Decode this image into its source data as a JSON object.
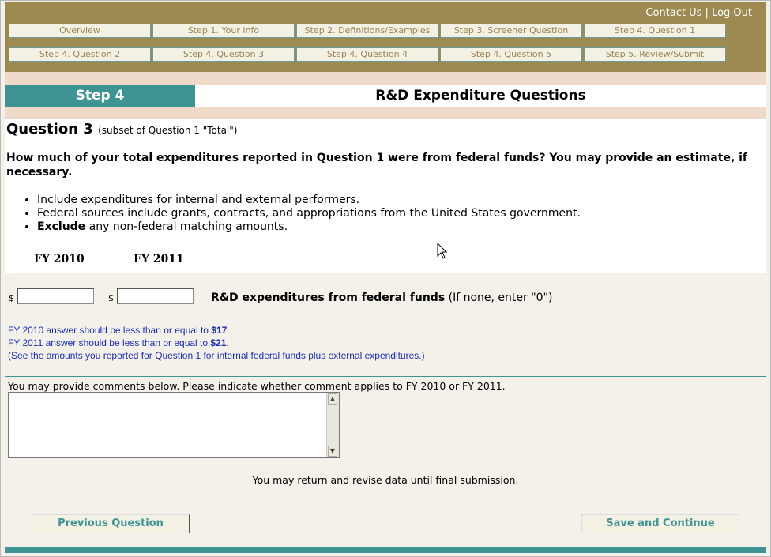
{
  "header": {
    "contact_label": "Contact Us",
    "separator": " | ",
    "logout_label": "Log Out",
    "nav": [
      "Overview",
      "Step 1. Your Info",
      "Step 2. Definitions/Examples",
      "Step 3. Screener Question",
      "Step 4. Question 1",
      "Step 4. Question 2",
      "Step 4. Question 3",
      "Step 4. Question 4",
      "Step 4. Question 5",
      "Step 5. Review/Submit"
    ]
  },
  "step": {
    "tag": "Step 4",
    "title": "R&D Expenditure Questions"
  },
  "question": {
    "title": "Question 3",
    "subtitle": "(subset of Question 1 \"Total\")",
    "text": "How much of your total expenditures reported in Question 1 were from federal funds? You may provide an estimate, if necessary.",
    "bullet1": "Include expenditures for internal and external performers.",
    "bullet2": "Federal sources include grants, contracts, and appropriations from the United States government.",
    "bullet3_bold": "Exclude",
    "bullet3_rest": " any non-federal matching amounts."
  },
  "years": {
    "fy1": "FY 2010",
    "fy2": "FY 2011"
  },
  "inputs": {
    "currency": "$",
    "fy2010_value": "",
    "fy2011_value": "",
    "label_bold": "R&D expenditures from federal funds",
    "label_rest": " (If none, enter \"0\")"
  },
  "hints": {
    "line1_text": "FY 2010 answer should be less than or equal to ",
    "line1_value": "$17",
    "line1_end": ".",
    "line2_text": "FY 2011 answer should be less than or equal to ",
    "line2_value": "$21",
    "line2_end": ".",
    "line3": "(See the amounts you reported for Question 1 for internal federal funds plus external expenditures.)"
  },
  "comments": {
    "label": "You may provide comments below. Please indicate whether comment applies to FY 2010 or FY 2011.",
    "value": ""
  },
  "note": "You may return and revise data until final submission.",
  "buttons": {
    "previous": "Previous Question",
    "save": "Save and Continue"
  },
  "colors": {
    "header_bg": "#9c8a50",
    "accent_teal": "#3e9493",
    "band_pink": "#efd9c9",
    "hint_blue": "#1a2dc0"
  }
}
